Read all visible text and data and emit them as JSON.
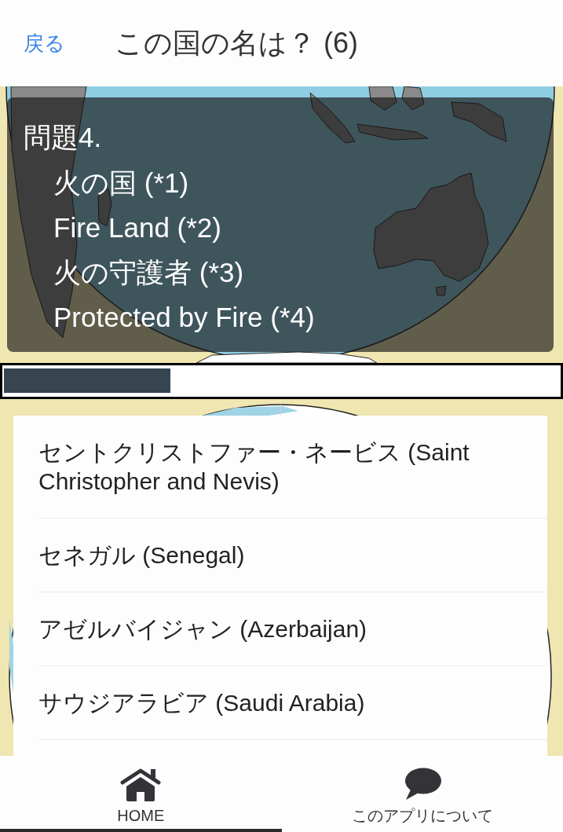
{
  "header": {
    "back_link": "戻る",
    "title": "この国の名は？ (6)"
  },
  "question": {
    "heading": "問題4.",
    "hints": [
      "火の国 (*1)",
      "Fire Land (*2)",
      "火の守護者 (*3)",
      "Protected by Fire (*4)"
    ]
  },
  "timer": {
    "level": 0.3
  },
  "answers": [
    "セントクリストファー・ネービス (Saint Christopher and Nevis)",
    "セネガル (Senegal)",
    "アゼルバイジャン (Azerbaijan)",
    "サウジアラビア (Saudi Arabia)"
  ],
  "bottom_nav": [
    {
      "kind": "home",
      "label": "HOME",
      "selected": true
    },
    {
      "kind": "about",
      "label": "このアプリについて",
      "selected": false
    }
  ]
}
